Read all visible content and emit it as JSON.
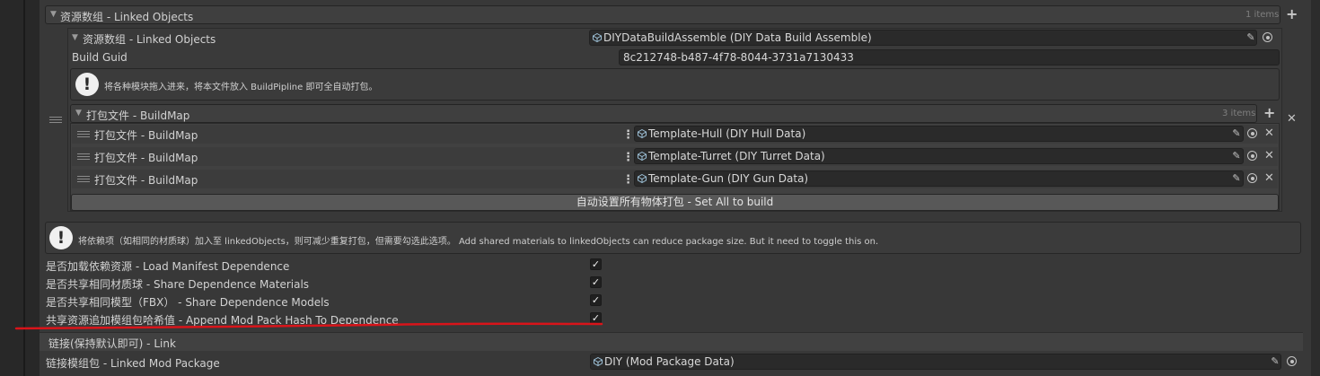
{
  "linked_objects_header": {
    "title": "资源数组 - Linked Objects",
    "count": "1 items",
    "add_icon": "plus-icon"
  },
  "element0": {
    "label": "资源数组 - Linked Objects",
    "object_value": "DIYDataBuildAssemble (DIY Data Build Assemble)",
    "build_guid_label": "Build Guid",
    "build_guid_value": "8c212748-b487-4f78-8044-3731a7130433",
    "help_text": "将各种模块拖入进来，将本文件放入 BuildPipline 即可全自动打包。"
  },
  "build_map": {
    "title": "打包文件 - BuildMap",
    "count": "3 items",
    "items": [
      {
        "label": "打包文件 - BuildMap",
        "value": "Template-Hull (DIY Hull Data)"
      },
      {
        "label": "打包文件 - BuildMap",
        "value": "Template-Turret (DIY Turret Data)"
      },
      {
        "label": "打包文件 - BuildMap",
        "value": "Template-Gun (DIY Gun Data)"
      }
    ],
    "set_all_button": "自动设置所有物体打包 - Set All to build"
  },
  "dependence_help": "将依赖项（如相同的材质球）加入至 linkedObjects，则可减少重复打包，但需要勾选此选项。 Add shared materials to linkedObjects can reduce package size. But it need to toggle this on.",
  "toggles": [
    {
      "label": "是否加载依赖资源 - Load Manifest Dependence",
      "checked": true
    },
    {
      "label": "是否共享相同材质球 - Share Dependence Materials",
      "checked": true
    },
    {
      "label": "是否共享相同模型（FBX） - Share Dependence Models",
      "checked": true
    },
    {
      "label": "共享资源追加模组包哈希值 - Append Mod Pack Hash To Dependence",
      "checked": true
    }
  ],
  "check_glyph": "✓",
  "link_section": {
    "title": "链接(保持默认即可) - Link",
    "linked_mod_label": "链接模组包 - Linked Mod Package",
    "linked_mod_value": "DIY (Mod Package Data)"
  },
  "icons": {
    "pencil": "✎",
    "plus": "+",
    "close": "✕",
    "kebab": "⋮",
    "foldout": "▼",
    "help": "!"
  },
  "colors": {
    "panel": "#383838",
    "field": "#2a2a2a",
    "button": "#585858",
    "annotation_red": "#d9141a"
  }
}
